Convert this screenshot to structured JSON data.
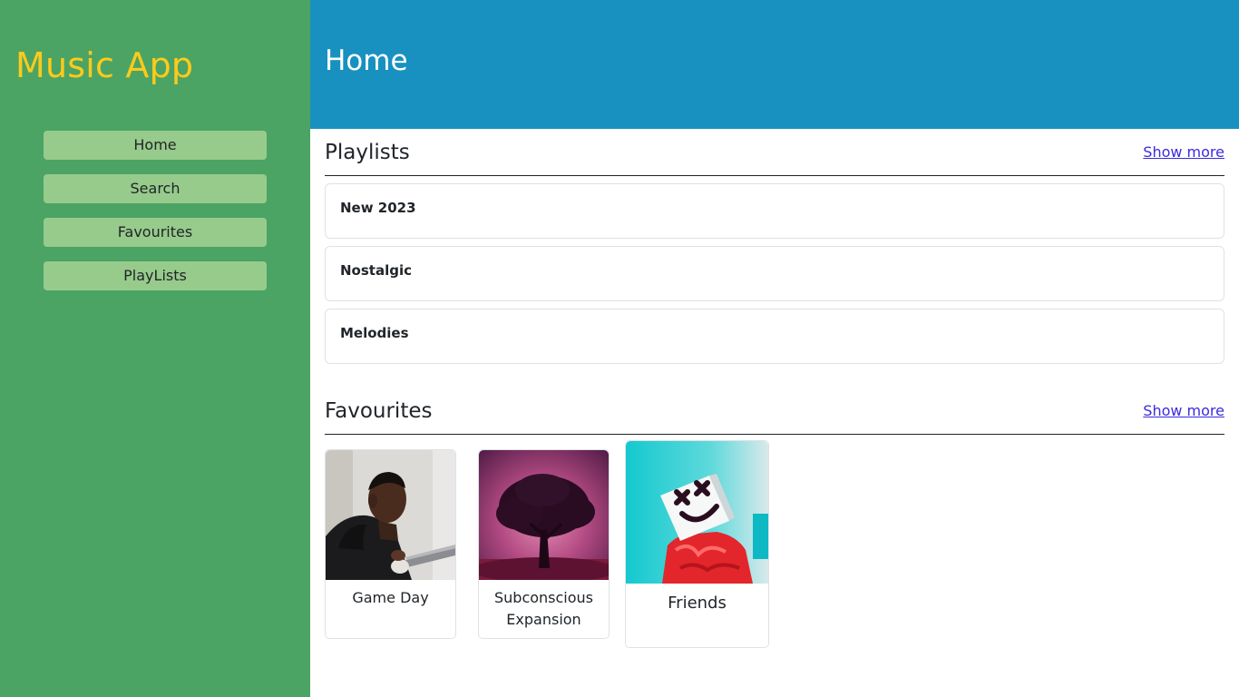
{
  "app": {
    "title": "Music App"
  },
  "nav": {
    "items": [
      {
        "label": "Home"
      },
      {
        "label": "Search"
      },
      {
        "label": "Favourites"
      },
      {
        "label": "PlayLists"
      }
    ]
  },
  "header": {
    "title": "Home"
  },
  "playlists": {
    "title": "Playlists",
    "show_more": "Show more",
    "items": [
      {
        "name": "New 2023"
      },
      {
        "name": "Nostalgic"
      },
      {
        "name": "Melodies"
      }
    ]
  },
  "favourites": {
    "title": "Favourites",
    "show_more": "Show more",
    "items": [
      {
        "name": "Game Day",
        "image": "man-with-guitar-photo"
      },
      {
        "name": "Subconscious Expansion",
        "image": "pink-tree-photo"
      },
      {
        "name": "Friends",
        "image": "marshmello-photo"
      }
    ]
  },
  "colors": {
    "sidebar": "#4ba463",
    "nav_button": "#97cb8c",
    "brand": "#ffca1a",
    "header": "#1891c1",
    "link": "#3b2bdc"
  }
}
